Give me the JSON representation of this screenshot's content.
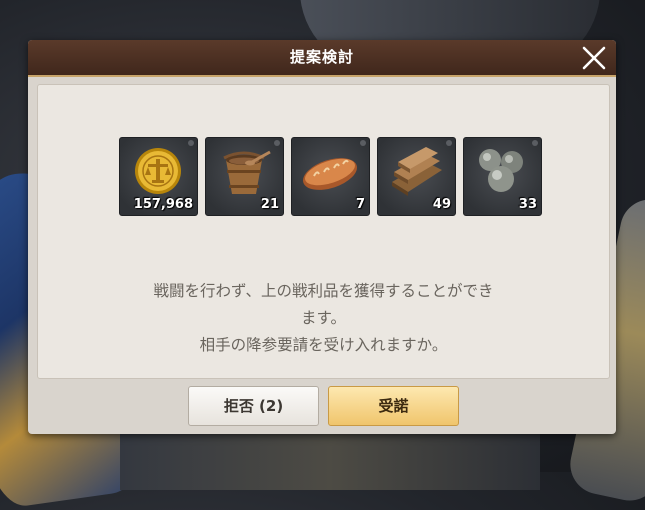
{
  "dialog": {
    "title": "提案検討",
    "close_icon": "close-icon"
  },
  "rewards": [
    {
      "icon": "gold-coin-icon",
      "count": "157,968"
    },
    {
      "icon": "water-bucket-icon",
      "count": "21"
    },
    {
      "icon": "bread-icon",
      "count": "7"
    },
    {
      "icon": "lumber-icon",
      "count": "49"
    },
    {
      "icon": "stone-balls-icon",
      "count": "33"
    }
  ],
  "message": {
    "line1": "戦闘を行わず、上の戦利品を獲得することができ",
    "line2": "ます。",
    "line3": "相手の降参要請を受け入れますか。"
  },
  "buttons": {
    "reject_label": "拒否 (2)",
    "accept_label": "受諾"
  },
  "colors": {
    "titlebar": "#4a2f22",
    "accept_button": "#f5d48a",
    "reject_button": "#f3f0ec",
    "message_text": "#6a655e"
  }
}
